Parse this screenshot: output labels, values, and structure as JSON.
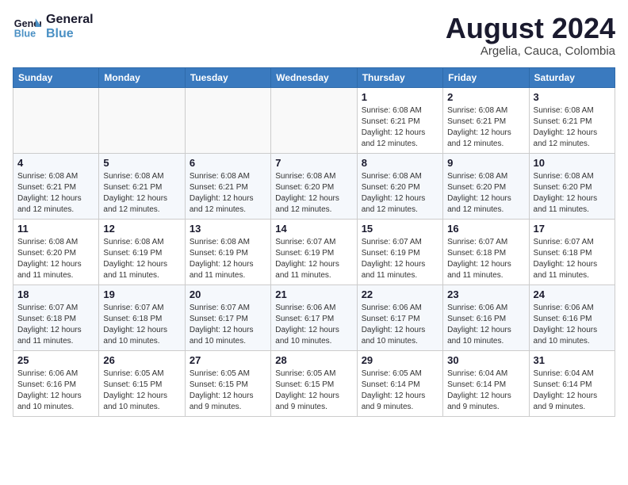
{
  "header": {
    "logo_line1": "General",
    "logo_line2": "Blue",
    "month_year": "August 2024",
    "location": "Argelia, Cauca, Colombia"
  },
  "weekdays": [
    "Sunday",
    "Monday",
    "Tuesday",
    "Wednesday",
    "Thursday",
    "Friday",
    "Saturday"
  ],
  "weeks": [
    [
      {
        "day": "",
        "info": ""
      },
      {
        "day": "",
        "info": ""
      },
      {
        "day": "",
        "info": ""
      },
      {
        "day": "",
        "info": ""
      },
      {
        "day": "1",
        "info": "Sunrise: 6:08 AM\nSunset: 6:21 PM\nDaylight: 12 hours\nand 12 minutes."
      },
      {
        "day": "2",
        "info": "Sunrise: 6:08 AM\nSunset: 6:21 PM\nDaylight: 12 hours\nand 12 minutes."
      },
      {
        "day": "3",
        "info": "Sunrise: 6:08 AM\nSunset: 6:21 PM\nDaylight: 12 hours\nand 12 minutes."
      }
    ],
    [
      {
        "day": "4",
        "info": "Sunrise: 6:08 AM\nSunset: 6:21 PM\nDaylight: 12 hours\nand 12 minutes."
      },
      {
        "day": "5",
        "info": "Sunrise: 6:08 AM\nSunset: 6:21 PM\nDaylight: 12 hours\nand 12 minutes."
      },
      {
        "day": "6",
        "info": "Sunrise: 6:08 AM\nSunset: 6:21 PM\nDaylight: 12 hours\nand 12 minutes."
      },
      {
        "day": "7",
        "info": "Sunrise: 6:08 AM\nSunset: 6:20 PM\nDaylight: 12 hours\nand 12 minutes."
      },
      {
        "day": "8",
        "info": "Sunrise: 6:08 AM\nSunset: 6:20 PM\nDaylight: 12 hours\nand 12 minutes."
      },
      {
        "day": "9",
        "info": "Sunrise: 6:08 AM\nSunset: 6:20 PM\nDaylight: 12 hours\nand 12 minutes."
      },
      {
        "day": "10",
        "info": "Sunrise: 6:08 AM\nSunset: 6:20 PM\nDaylight: 12 hours\nand 11 minutes."
      }
    ],
    [
      {
        "day": "11",
        "info": "Sunrise: 6:08 AM\nSunset: 6:20 PM\nDaylight: 12 hours\nand 11 minutes."
      },
      {
        "day": "12",
        "info": "Sunrise: 6:08 AM\nSunset: 6:19 PM\nDaylight: 12 hours\nand 11 minutes."
      },
      {
        "day": "13",
        "info": "Sunrise: 6:08 AM\nSunset: 6:19 PM\nDaylight: 12 hours\nand 11 minutes."
      },
      {
        "day": "14",
        "info": "Sunrise: 6:07 AM\nSunset: 6:19 PM\nDaylight: 12 hours\nand 11 minutes."
      },
      {
        "day": "15",
        "info": "Sunrise: 6:07 AM\nSunset: 6:19 PM\nDaylight: 12 hours\nand 11 minutes."
      },
      {
        "day": "16",
        "info": "Sunrise: 6:07 AM\nSunset: 6:18 PM\nDaylight: 12 hours\nand 11 minutes."
      },
      {
        "day": "17",
        "info": "Sunrise: 6:07 AM\nSunset: 6:18 PM\nDaylight: 12 hours\nand 11 minutes."
      }
    ],
    [
      {
        "day": "18",
        "info": "Sunrise: 6:07 AM\nSunset: 6:18 PM\nDaylight: 12 hours\nand 11 minutes."
      },
      {
        "day": "19",
        "info": "Sunrise: 6:07 AM\nSunset: 6:18 PM\nDaylight: 12 hours\nand 10 minutes."
      },
      {
        "day": "20",
        "info": "Sunrise: 6:07 AM\nSunset: 6:17 PM\nDaylight: 12 hours\nand 10 minutes."
      },
      {
        "day": "21",
        "info": "Sunrise: 6:06 AM\nSunset: 6:17 PM\nDaylight: 12 hours\nand 10 minutes."
      },
      {
        "day": "22",
        "info": "Sunrise: 6:06 AM\nSunset: 6:17 PM\nDaylight: 12 hours\nand 10 minutes."
      },
      {
        "day": "23",
        "info": "Sunrise: 6:06 AM\nSunset: 6:16 PM\nDaylight: 12 hours\nand 10 minutes."
      },
      {
        "day": "24",
        "info": "Sunrise: 6:06 AM\nSunset: 6:16 PM\nDaylight: 12 hours\nand 10 minutes."
      }
    ],
    [
      {
        "day": "25",
        "info": "Sunrise: 6:06 AM\nSunset: 6:16 PM\nDaylight: 12 hours\nand 10 minutes."
      },
      {
        "day": "26",
        "info": "Sunrise: 6:05 AM\nSunset: 6:15 PM\nDaylight: 12 hours\nand 10 minutes."
      },
      {
        "day": "27",
        "info": "Sunrise: 6:05 AM\nSunset: 6:15 PM\nDaylight: 12 hours\nand 9 minutes."
      },
      {
        "day": "28",
        "info": "Sunrise: 6:05 AM\nSunset: 6:15 PM\nDaylight: 12 hours\nand 9 minutes."
      },
      {
        "day": "29",
        "info": "Sunrise: 6:05 AM\nSunset: 6:14 PM\nDaylight: 12 hours\nand 9 minutes."
      },
      {
        "day": "30",
        "info": "Sunrise: 6:04 AM\nSunset: 6:14 PM\nDaylight: 12 hours\nand 9 minutes."
      },
      {
        "day": "31",
        "info": "Sunrise: 6:04 AM\nSunset: 6:14 PM\nDaylight: 12 hours\nand 9 minutes."
      }
    ]
  ]
}
